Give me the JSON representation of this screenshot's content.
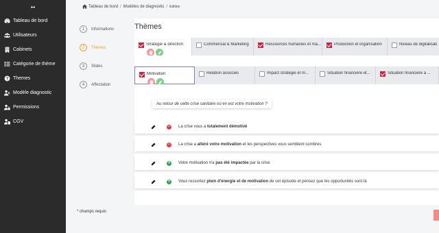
{
  "sidebar": {
    "toggle_icon": "arrows-horizontal-icon",
    "items": [
      {
        "label": "Tableau de bord",
        "icon": "dashboard-icon"
      },
      {
        "label": "Utilisateurs",
        "icon": "users-icon"
      },
      {
        "label": "Cabinets",
        "icon": "building-icon"
      },
      {
        "label": "Catégorie de thème",
        "icon": "list-icon"
      },
      {
        "label": "Themes",
        "icon": "question-circle-icon"
      },
      {
        "label": "Modèle diagnostic",
        "icon": "diagnostic-icon"
      },
      {
        "label": "Permissions",
        "icon": "user-lock-icon"
      },
      {
        "label": "CGV",
        "icon": "user-file-icon"
      }
    ]
  },
  "breadcrumb": {
    "home": "Tableau de bord",
    "section": "Modèles de diagnostic",
    "current": "Edition"
  },
  "steps": [
    {
      "num": "1",
      "label": "Informations"
    },
    {
      "num": "2",
      "label": "Thèmes"
    },
    {
      "num": "3",
      "label": "Slides"
    },
    {
      "num": "4",
      "label": "Affectation"
    }
  ],
  "main": {
    "title": "Thèmes",
    "themes": [
      {
        "label": "Stratégie & direction",
        "checked": true
      },
      {
        "label": "Commercial & Marketing",
        "checked": false
      },
      {
        "label": "Ressources humaines et ma...",
        "checked": true
      },
      {
        "label": "Production et organisation",
        "checked": true
      },
      {
        "label": "Niveau de digitalisati",
        "checked": false
      }
    ],
    "subthemes": [
      {
        "label": "Motivation",
        "checked": true
      },
      {
        "label": "Relation associés",
        "checked": false
      },
      {
        "label": "Impact stratégie et m...",
        "checked": false
      },
      {
        "label": "Situation financière et...",
        "checked": false
      },
      {
        "label": "Situation financière à ...",
        "checked": true
      }
    ],
    "question": "Au retour de cette crise sanitaire où en est votre motivation ?",
    "answers": [
      {
        "sign": "minus",
        "pre": "La crise vous a ",
        "bold": "totalement démotivé",
        "post": ""
      },
      {
        "sign": "minus",
        "pre": "La crise a ",
        "bold": "altéré votre motivation",
        "post": " et les perspectives vous semblent sombres"
      },
      {
        "sign": "plus",
        "pre": "Votre motivation n'a ",
        "bold": "pas été impactée",
        "post": " par la crise"
      },
      {
        "sign": "plus",
        "pre": "Vous ressortez ",
        "bold": "plein d'énergie et de motivation",
        "post": " de cet épisode et pensez que les opportunités sont là"
      }
    ]
  },
  "footer": {
    "required_note": "* champs requis"
  },
  "colors": {
    "accent": "#f0a020",
    "checked": "#d3223e",
    "sidebar_bg": "#2b2b2b",
    "delete": "#f2999f",
    "edit": "#7ccf86",
    "negative": "#e13a44",
    "positive": "#2ea44f"
  }
}
